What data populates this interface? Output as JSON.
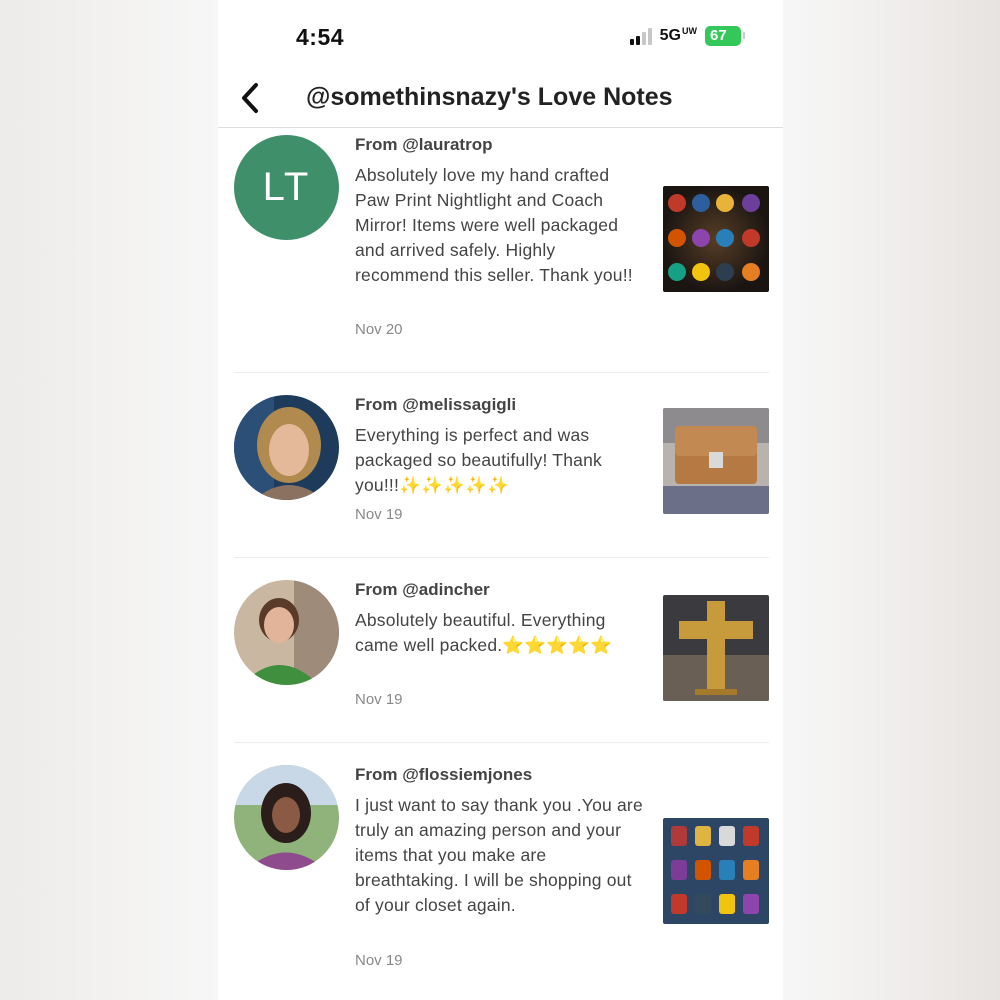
{
  "status_bar": {
    "time": "4:54",
    "network": "5G",
    "network_suffix": "UW",
    "battery": "67"
  },
  "header": {
    "title": "@somethinsnazy's Love Notes",
    "back_icon": "chevron-left-icon"
  },
  "reviews": [
    {
      "avatar_initials": "LT",
      "from": "From @lauratrop",
      "text": "Absolutely love my hand crafted Paw Print Nightlight and Coach Mirror! Items were well packaged and arrived safely. Highly recommend this seller. Thank you!!",
      "date": "Nov 20"
    },
    {
      "from": "From @melissagigli",
      "text": "Everything is perfect and was packaged so beautifully! Thank you!!!✨✨✨✨✨",
      "date": "Nov 19"
    },
    {
      "from": "From @adincher",
      "text": "Absolutely beautiful. Everything came well packed.⭐⭐⭐⭐⭐",
      "date": "Nov 19"
    },
    {
      "from": "From @flossiemjones",
      "text": "I just want to say thank you .You are truly an amazing person and your items that you make are breathtaking. I will be shopping out of your closet again.",
      "date": "Nov 19"
    }
  ],
  "colors": {
    "avatar_lt": "#3f8f6a",
    "battery": "#34c759"
  }
}
